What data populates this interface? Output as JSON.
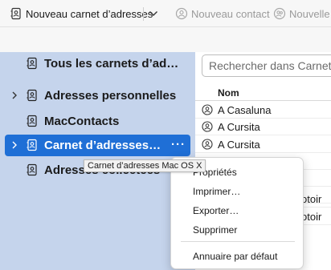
{
  "toolbar": {
    "new_address_book": "Nouveau carnet d’adresses",
    "new_contact": "Nouveau contact",
    "new_list": "Nouvelle li"
  },
  "sidebar": {
    "items": [
      {
        "label": "Tous les carnets d’adre…",
        "has_twisty": false,
        "selected": false,
        "icon": "address-book-icon"
      },
      {
        "label": "Adresses personnelles",
        "has_twisty": true,
        "selected": false,
        "icon": "address-book-icon"
      },
      {
        "label": "MacContacts",
        "has_twisty": false,
        "selected": false,
        "icon": "address-book-icon"
      },
      {
        "label": "Carnet d’adresses …",
        "has_twisty": true,
        "selected": true,
        "icon": "address-book-icon",
        "more": "···"
      },
      {
        "label": "Adresses collectées",
        "has_twisty": false,
        "selected": false,
        "icon": "address-book-icon"
      }
    ]
  },
  "search": {
    "placeholder": "Rechercher dans Carnet"
  },
  "list": {
    "column_name": "Nom",
    "rows": [
      {
        "name": "A Casaluna",
        "tail": ""
      },
      {
        "name": "A Cursita",
        "tail": ""
      },
      {
        "name": "A Cursita",
        "tail": ""
      },
      {
        "name": "",
        "tail": ""
      },
      {
        "name": "",
        "tail": ""
      },
      {
        "name": "",
        "tail": ""
      },
      {
        "name": "",
        "tail": "otoir"
      },
      {
        "name": "",
        "tail": "otoir"
      }
    ]
  },
  "tooltip": {
    "text": "Carnet d’adresses Mac OS X"
  },
  "context_menu": {
    "items": [
      "Propriétés",
      "Imprimer…",
      "Exporter…",
      "Supprimer"
    ],
    "default_item": "Annuaire par défaut"
  },
  "colors": {
    "selection": "#1f6fd6",
    "sidebar_bg": "#c5d4ec",
    "disabled_text": "#9a9a9a"
  }
}
